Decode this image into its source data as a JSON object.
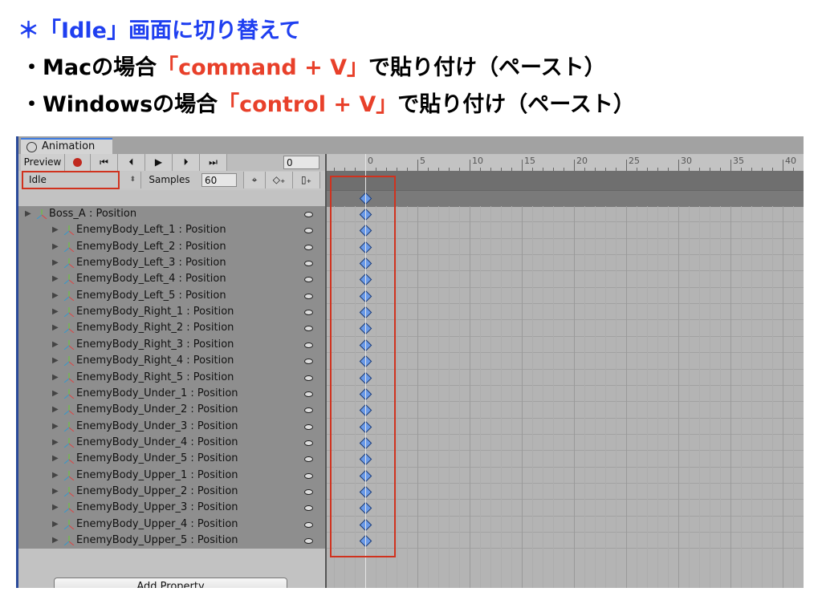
{
  "slide": {
    "heading": "＊「Idle」画面に切り替えて",
    "mac_prefix": "・Macの場合",
    "mac_keys": "「command + V」",
    "mac_suffix": "で貼り付け（ペースト）",
    "win_prefix": "・Windowsの場合",
    "win_keys": "「control + V」",
    "win_suffix": "で貼り付け（ペースト）",
    "colors": {
      "heading": "#1f3ff0",
      "keys": "#e8402a",
      "highlight_box": "#d0321e"
    }
  },
  "window": {
    "tab_title": "Animation",
    "tab_icon": "clock-icon",
    "toolbar": {
      "preview": "Preview",
      "record_icon": "record-icon",
      "first_key_icon": "skip-to-start-icon",
      "prev_key_icon": "prev-key-icon",
      "play_icon": "play-icon",
      "next_key_icon": "next-key-icon",
      "last_key_icon": "skip-to-end-icon",
      "frame": "0",
      "clip": "Idle",
      "samples_label": "Samples",
      "samples": "60",
      "add_keyframe_icon": "add-keyframe-icon",
      "add_event_icon": "add-event-icon",
      "target_icon": "crosshair-icon"
    },
    "properties": [
      "Boss_A : Position",
      "EnemyBody_Left_1 : Position",
      "EnemyBody_Left_2 : Position",
      "EnemyBody_Left_3 : Position",
      "EnemyBody_Left_4 : Position",
      "EnemyBody_Left_5 : Position",
      "EnemyBody_Right_1 : Position",
      "EnemyBody_Right_2 : Position",
      "EnemyBody_Right_3 : Position",
      "EnemyBody_Right_4 : Position",
      "EnemyBody_Right_5 : Position",
      "EnemyBody_Under_1 : Position",
      "EnemyBody_Under_2 : Position",
      "EnemyBody_Under_3 : Position",
      "EnemyBody_Under_4 : Position",
      "EnemyBody_Under_5 : Position",
      "EnemyBody_Upper_1 : Position",
      "EnemyBody_Upper_2 : Position",
      "EnemyBody_Upper_3 : Position",
      "EnemyBody_Upper_4 : Position",
      "EnemyBody_Upper_5 : Position"
    ],
    "add_property": "Add Property",
    "timeline": {
      "ticks": [
        "0",
        "5",
        "10",
        "15",
        "20",
        "25",
        "30",
        "35",
        "40"
      ],
      "keyframe_at": "0"
    }
  }
}
